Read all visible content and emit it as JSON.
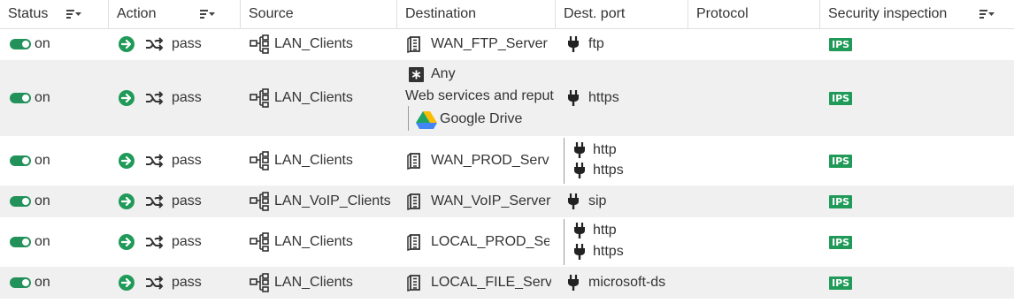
{
  "columns": {
    "status": "Status",
    "action": "Action",
    "source": "Source",
    "destination": "Destination",
    "dest_port": "Dest. port",
    "protocol": "Protocol",
    "security_inspection": "Security inspection"
  },
  "rows": [
    {
      "status": "on",
      "action": "pass",
      "source": "LAN_Clients",
      "destination": "WAN_FTP_Server",
      "ports": [
        "ftp"
      ],
      "inspection": "IPS"
    },
    {
      "status": "on",
      "action": "pass",
      "source": "LAN_Clients",
      "destination_any": "Any",
      "destination_category": "Web services and reput",
      "destination_service": "Google Drive",
      "ports": [
        "https"
      ],
      "inspection": "IPS"
    },
    {
      "status": "on",
      "action": "pass",
      "source": "LAN_Clients",
      "destination": "WAN_PROD_Serve",
      "ports": [
        "http",
        "https"
      ],
      "inspection": "IPS"
    },
    {
      "status": "on",
      "action": "pass",
      "source": "LAN_VoIP_Clients",
      "destination": "WAN_VoIP_Server",
      "ports": [
        "sip"
      ],
      "inspection": "IPS"
    },
    {
      "status": "on",
      "action": "pass",
      "source": "LAN_Clients",
      "destination": "LOCAL_PROD_Ser",
      "ports": [
        "http",
        "https"
      ],
      "inspection": "IPS"
    },
    {
      "status": "on",
      "action": "pass",
      "source": "LAN_Clients",
      "destination": "LOCAL_FILE_Serve",
      "ports": [
        "microsoft-ds"
      ],
      "inspection": "IPS"
    }
  ],
  "colors": {
    "toggle_on": "#23915a",
    "action_pass": "#1f9a58",
    "ips_badge": "#1f9a58",
    "alt_row": "#f0f0f0"
  }
}
